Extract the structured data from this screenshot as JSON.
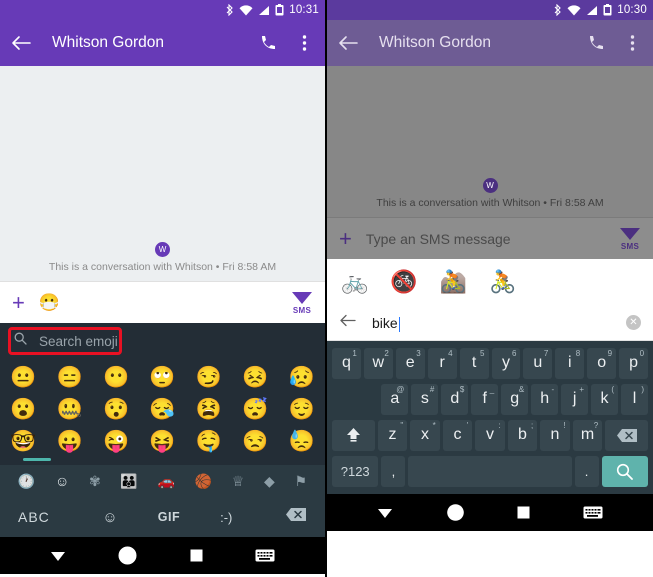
{
  "left": {
    "status": {
      "time": "10:31",
      "icons": [
        "bluetooth-icon",
        "wifi-icon",
        "signal-icon",
        "battery-icon"
      ]
    },
    "appbar": {
      "back_label": "back-arrow",
      "title": "Whitson Gordon",
      "call_label": "phone-icon",
      "menu_label": "overflow-menu-icon"
    },
    "conversation": {
      "avatar_initial": "W",
      "note": "This is a conversation with Whitson • Fri 8:58 AM"
    },
    "compose": {
      "attach_label": "+",
      "emoji_button": "😷",
      "send_label": "SMS"
    },
    "emoji_search": {
      "placeholder": "Search emoji",
      "icon": "search-icon",
      "highlight_color": "#e81123"
    },
    "emoji_grid": {
      "rows": [
        [
          "😐",
          "😑",
          "😶",
          "🙄",
          "😏",
          "😣",
          "😥"
        ],
        [
          "😮",
          "🤐",
          "😯",
          "😪",
          "😫",
          "😴",
          "😌"
        ],
        [
          "🤓",
          "😛",
          "😜",
          "😝",
          "🤤",
          "😒",
          "😓"
        ]
      ]
    },
    "categories": [
      {
        "name": "recent-category",
        "glyph": "🕐",
        "active": false
      },
      {
        "name": "smileys-category",
        "glyph": "☺",
        "active": true
      },
      {
        "name": "nature-category",
        "glyph": "✾",
        "active": false
      },
      {
        "name": "people-category",
        "glyph": "👪",
        "active": false
      },
      {
        "name": "travel-category",
        "glyph": "🚗",
        "active": false
      },
      {
        "name": "activity-category",
        "glyph": "🏀",
        "active": false
      },
      {
        "name": "objects-category",
        "glyph": "♕",
        "active": false
      },
      {
        "name": "symbols-category",
        "glyph": "◆",
        "active": false
      },
      {
        "name": "flags-category",
        "glyph": "⚑",
        "active": false
      }
    ],
    "bottom_bar": {
      "abc": "ABC",
      "smiley": "☺",
      "gif": "GIF",
      "kaomoji": ":-)",
      "backspace": "⌫"
    },
    "navbar": {
      "back": "▼",
      "home": "home-circle",
      "recents": "◼",
      "keyboard": "⌨"
    }
  },
  "right": {
    "status": {
      "time": "10:30",
      "icons": [
        "bluetooth-icon",
        "wifi-icon",
        "signal-icon",
        "battery-icon"
      ]
    },
    "appbar": {
      "back_label": "back-arrow",
      "title": "Whitson Gordon",
      "call_label": "phone-icon",
      "menu_label": "overflow-menu-icon"
    },
    "conversation": {
      "avatar_initial": "W",
      "note": "This is a conversation with Whitson • Fri 8:58 AM"
    },
    "compose": {
      "attach_label": "+",
      "placeholder": "Type an SMS message",
      "send_label": "SMS"
    },
    "results": [
      "🚲",
      "🚳",
      "🚵",
      "🚴"
    ],
    "search": {
      "back_icon": "back-arrow-icon",
      "value": "bike",
      "clear_icon": "✕"
    },
    "keyboard": {
      "row1": [
        {
          "k": "q",
          "s": "1"
        },
        {
          "k": "w",
          "s": "2"
        },
        {
          "k": "e",
          "s": "3"
        },
        {
          "k": "r",
          "s": "4"
        },
        {
          "k": "t",
          "s": "5"
        },
        {
          "k": "y",
          "s": "6"
        },
        {
          "k": "u",
          "s": "7"
        },
        {
          "k": "i",
          "s": "8"
        },
        {
          "k": "o",
          "s": "9"
        },
        {
          "k": "p",
          "s": "0"
        }
      ],
      "row2": [
        {
          "k": "a",
          "s": "@"
        },
        {
          "k": "s",
          "s": "#"
        },
        {
          "k": "d",
          "s": "$"
        },
        {
          "k": "f",
          "s": "_"
        },
        {
          "k": "g",
          "s": "&"
        },
        {
          "k": "h",
          "s": "-"
        },
        {
          "k": "j",
          "s": "+"
        },
        {
          "k": "k",
          "s": "("
        },
        {
          "k": "l",
          "s": ")"
        }
      ],
      "row3": [
        {
          "k": "z",
          "s": "\""
        },
        {
          "k": "x",
          "s": "*"
        },
        {
          "k": "c",
          "s": "'"
        },
        {
          "k": "v",
          "s": ":"
        },
        {
          "k": "b",
          "s": ";"
        },
        {
          "k": "n",
          "s": "!"
        },
        {
          "k": "m",
          "s": "?"
        }
      ],
      "shift": "⇧",
      "backspace": "⌫",
      "symbols": "?123",
      "comma": ",",
      "space": "",
      "period": ".",
      "search": "search-icon"
    },
    "navbar": {
      "back": "▼",
      "home": "home-circle",
      "recents": "◼",
      "keyboard": "⌨"
    }
  }
}
